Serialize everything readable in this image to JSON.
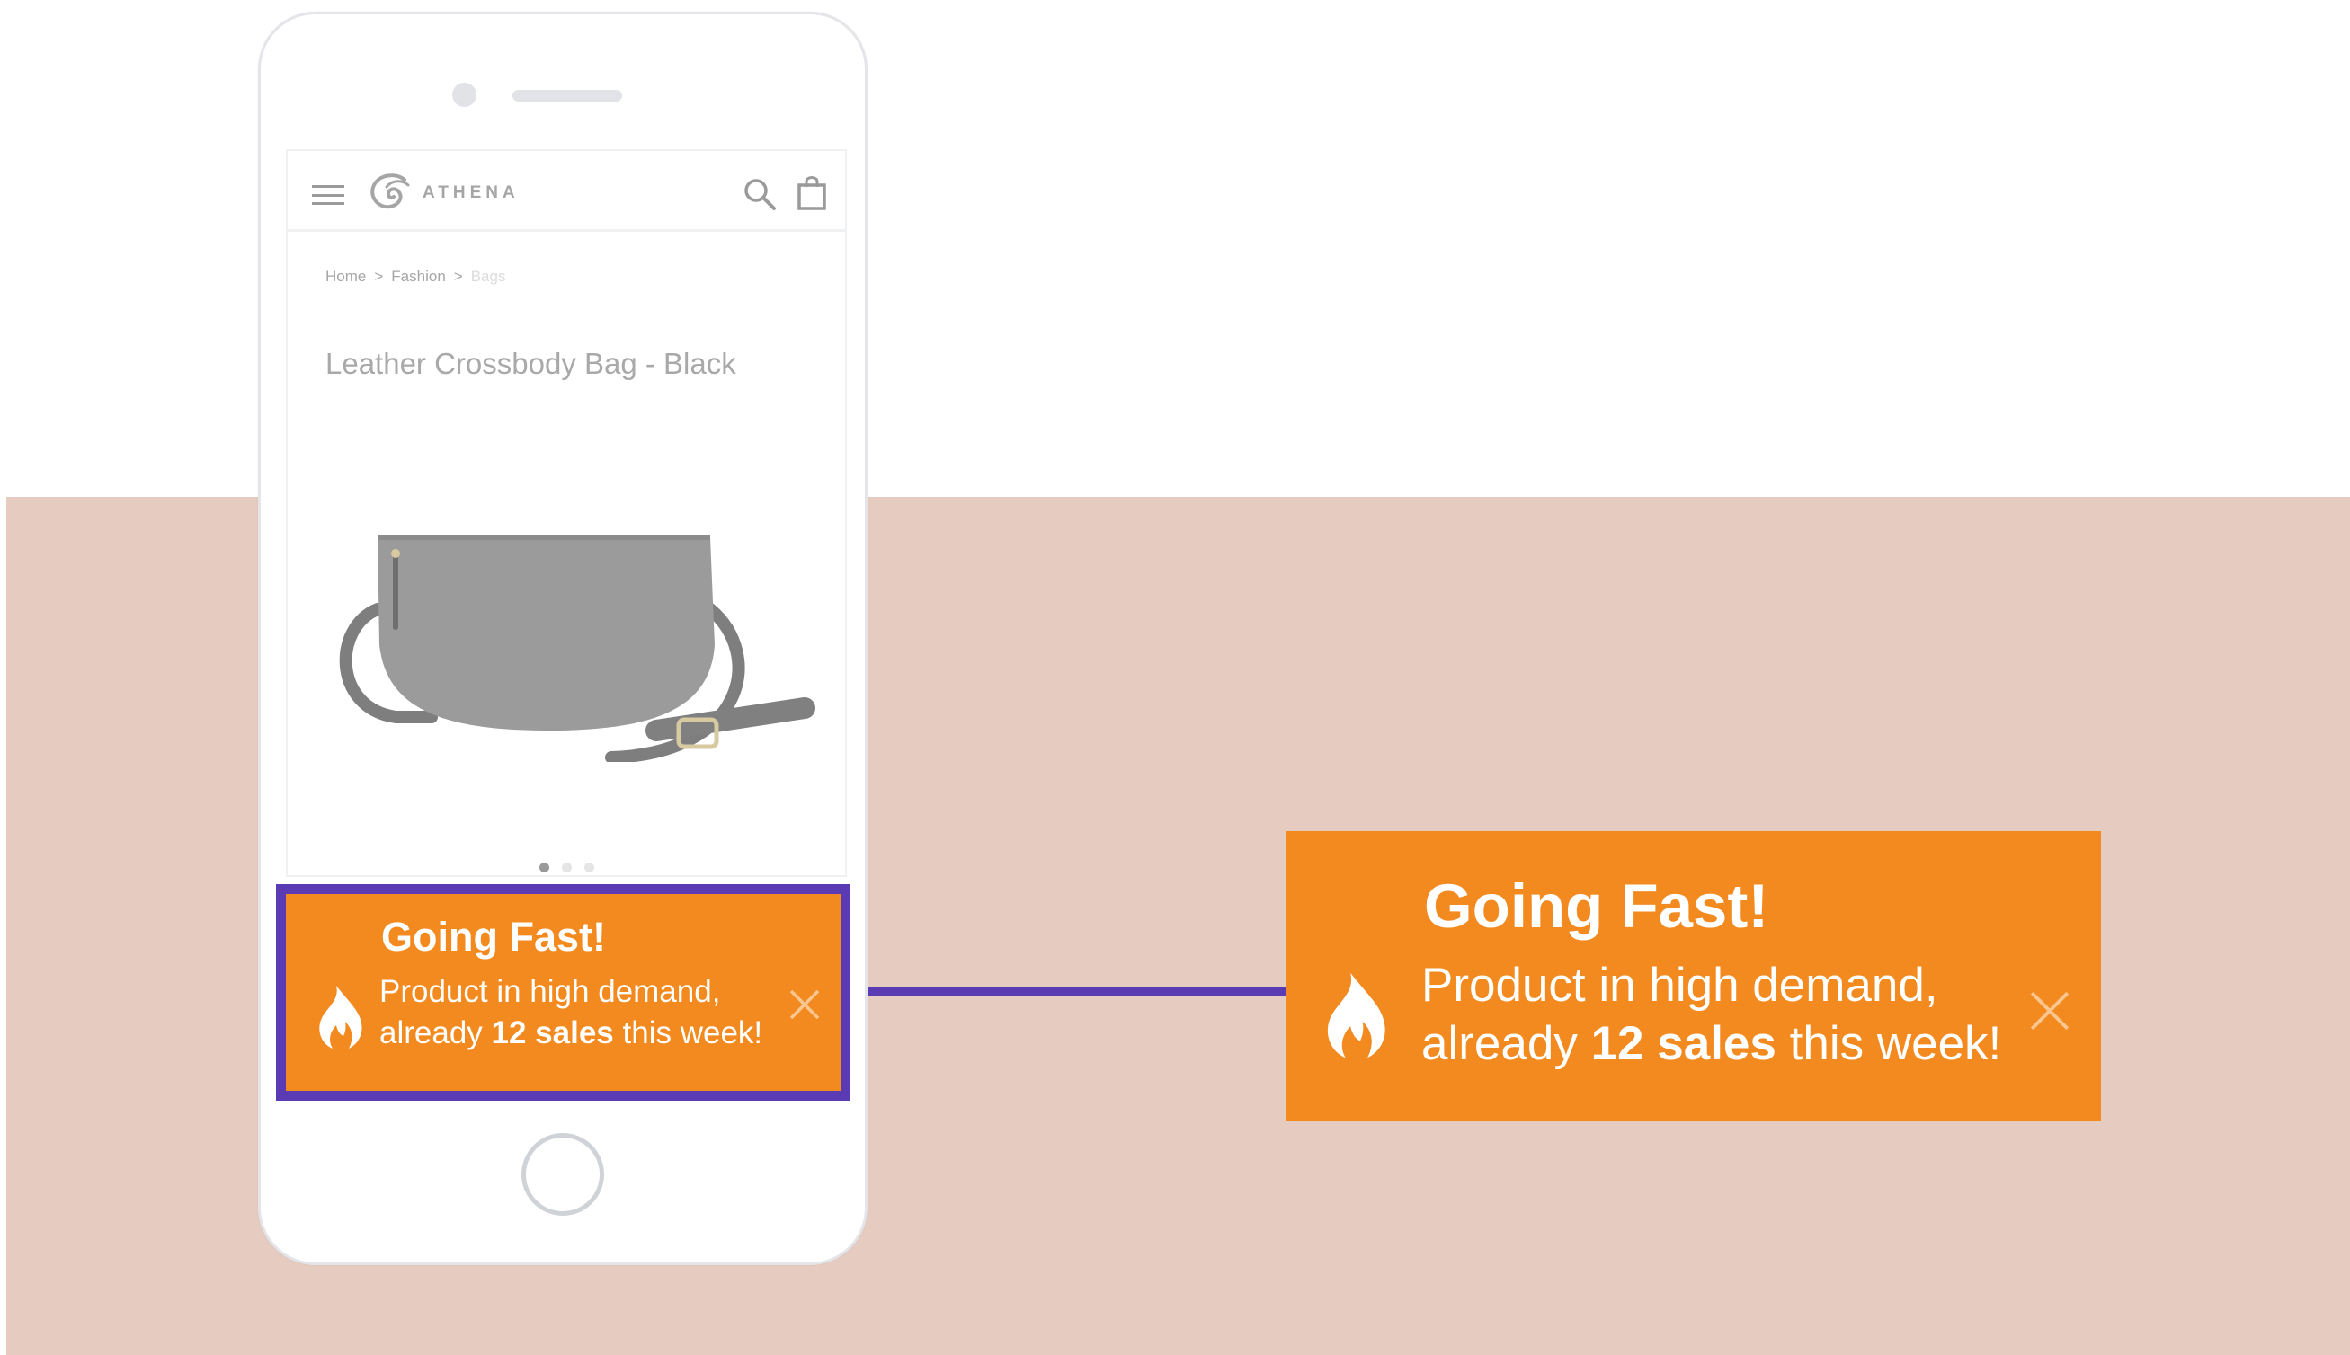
{
  "colors": {
    "band": "#e6cbc1",
    "notification": "#f28a1f",
    "highlight": "#5b3bb4"
  },
  "site": {
    "logo_text": "ATHENA",
    "menu_icon": "hamburger-icon",
    "search_icon": "search-icon",
    "cart_icon": "shopping-bag-icon"
  },
  "breadcrumb": {
    "home": "Home",
    "separator": ">",
    "category": "Fashion",
    "current": "Bags"
  },
  "product": {
    "title": "Leather Crossbody Bag - Black",
    "image_icon": "crossbody-bag-image",
    "carousel_dots": 3,
    "active_dot": 1
  },
  "notification": {
    "title": "Going Fast!",
    "line1": "Product in high demand,",
    "line2_prefix": "already",
    "line2_count": "12 sales",
    "line2_suffix": "this week!",
    "icon": "fire-icon",
    "close_icon": "close-icon"
  }
}
